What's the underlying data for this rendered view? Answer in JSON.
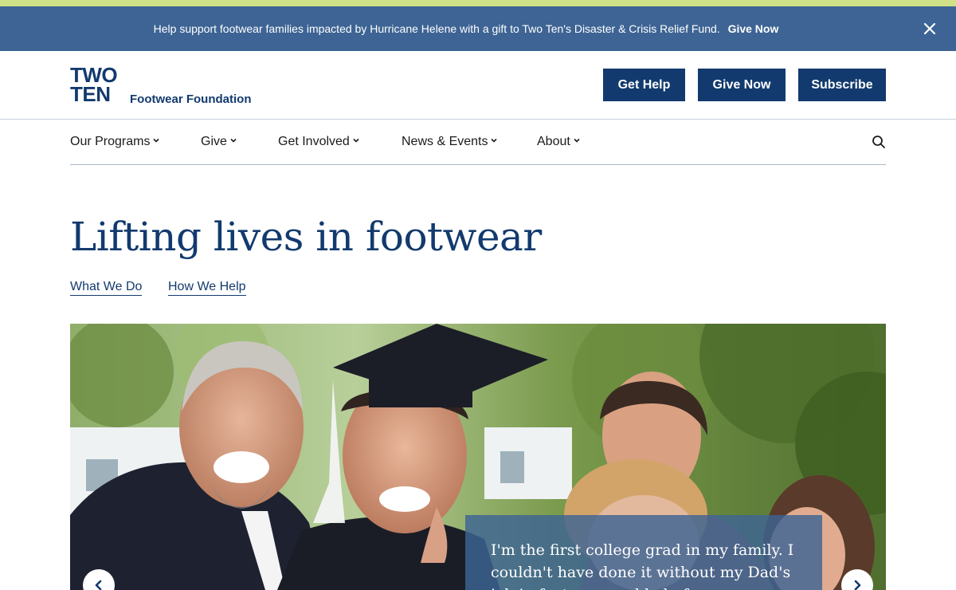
{
  "alert": {
    "message": "Help support footwear families impacted by Hurricane Helene with a gift to Two Ten's Disaster & Crisis Relief Fund.",
    "link_label": "Give Now",
    "close_icon": "close-icon"
  },
  "logo": {
    "line1": "TWO",
    "line2": "TEN",
    "subtitle": "Footwear Foundation"
  },
  "header_buttons": {
    "get_help": "Get Help",
    "give_now": "Give Now",
    "subscribe": "Subscribe"
  },
  "nav": {
    "items": [
      {
        "label": "Our Programs"
      },
      {
        "label": "Give"
      },
      {
        "label": "Get Involved"
      },
      {
        "label": "News & Events"
      },
      {
        "label": "About"
      }
    ],
    "search_icon": "search-icon"
  },
  "hero": {
    "title": "Lifting lives in footwear",
    "links": [
      {
        "label": "What We Do"
      },
      {
        "label": "How We Help"
      }
    ],
    "quote": "I'm the first college grad in my family. I couldn't have done it without my Dad's job in footwear and help from"
  },
  "colors": {
    "brand_navy": "#123a6e",
    "alert_blue": "#3d6494",
    "top_stripe": "#cfe086"
  }
}
